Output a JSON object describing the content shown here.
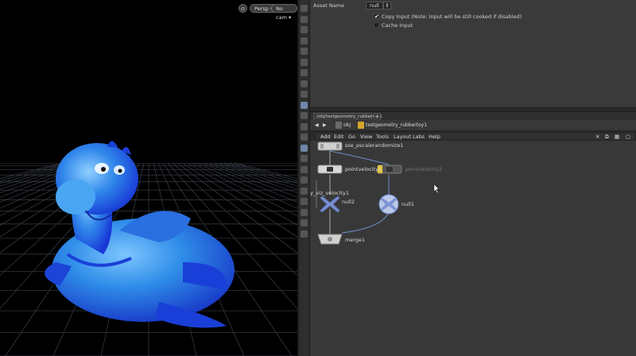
{
  "viewport": {
    "view_menu": "Persp ▾",
    "cam_menu": "No cam ▾",
    "colors": {
      "background": "#000000",
      "grid": "#3a3f48",
      "toy_main": "#2f8de8",
      "toy_dark": "#1a3fd8"
    }
  },
  "toolbar": {
    "icons": [
      "select-icon",
      "move-icon",
      "lock-icon",
      "snap-icon",
      "view-icon",
      "light-icon",
      "light-icon",
      "camera-icon",
      "display-icon",
      "scene-icon",
      "handle-icon",
      "geometry-icon",
      "wire-icon",
      "shade-icon",
      "point-icon",
      "normal-icon",
      "template-icon",
      "ghost-icon",
      "guide-icon",
      "background-icon",
      "paint-icon",
      "render-icon"
    ]
  },
  "params": {
    "asset_name_label": "Asset Name",
    "asset_name_value": "null",
    "copy_input_label": "Copy Input (Note: Input will be still cooked if disabled)",
    "copy_input_checked": "✔",
    "cache_input_label": "Cache Input"
  },
  "network": {
    "tab_label": "/obj/testgeometry_rubbertoy1",
    "add_tab": "+",
    "path_obj": "obj",
    "path_node": "testgeometry_rubbertoy1",
    "menu": [
      "Add",
      "Edit",
      "Go",
      "View",
      "Tools",
      "Layout",
      "Labs",
      "Help"
    ],
    "nodes": {
      "randomize": "sse_pscalerandomize1",
      "pointvelocity1": "pointvelocity1",
      "pointvelocity2": "pointvelocity2",
      "viz_velocity": "y_viz_velocity1",
      "null2": "null2",
      "null1": "null1",
      "merge1": "merge1"
    },
    "colors": {
      "bg": "#383838",
      "wire": "#aaaaaa",
      "wire_blue": "#6c8cc8",
      "node": "#cfcfcf",
      "null_fill": "#7b93d4",
      "flag": "#e4c43c"
    }
  }
}
